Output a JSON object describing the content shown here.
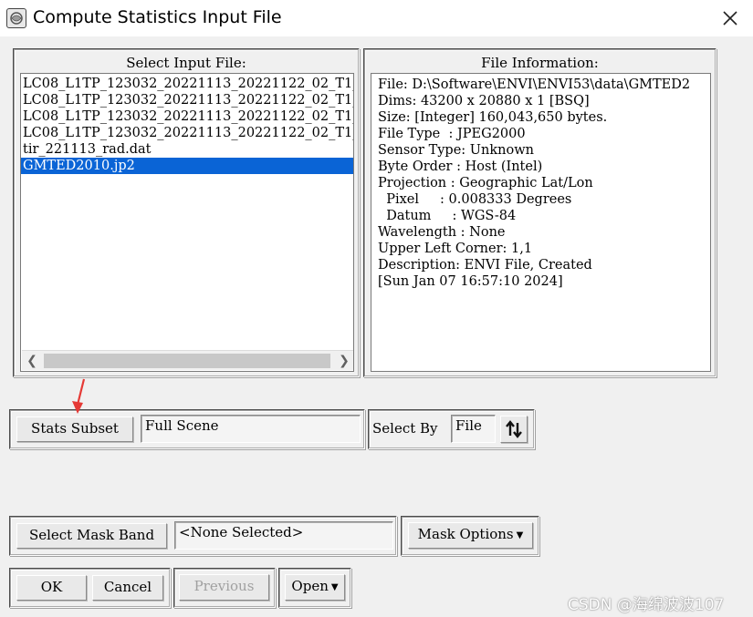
{
  "window": {
    "title": "Compute Statistics Input File",
    "close_icon": "close-icon",
    "app_icon": "envi-app-icon"
  },
  "select_input": {
    "label": "Select Input File:",
    "files": [
      "LC08_L1TP_123032_20221113_20221122_02_T1_",
      "LC08_L1TP_123032_20221113_20221122_02_T1_",
      "LC08_L1TP_123032_20221113_20221122_02_T1_",
      "LC08_L1TP_123032_20221113_20221122_02_T1_",
      "tir_221113_rad.dat",
      "GMTED2010.jp2"
    ],
    "selected_index": 5,
    "scroll_left_icon": "chevron-left-icon",
    "scroll_right_icon": "chevron-right-icon"
  },
  "file_info": {
    "label": "File Information:",
    "lines": [
      "File: D:\\Software\\ENVI\\ENVI53\\data\\GMTED2",
      "Dims: 43200 x 20880 x 1 [BSQ]",
      "Size: [Integer] 160,043,650 bytes.",
      "File Type  : JPEG2000",
      "Sensor Type: Unknown",
      "Byte Order : Host (Intel)",
      "Projection : Geographic Lat/Lon",
      "  Pixel     : 0.008333 Degrees",
      "  Datum     : WGS-84",
      "Wavelength : None",
      "Upper Left Corner: 1,1",
      "Description: ENVI File, Created",
      "[Sun Jan 07 16:57:10 2024]"
    ]
  },
  "stats_subset": {
    "button_label": "Stats Subset",
    "value": "Full Scene"
  },
  "select_by": {
    "label": "Select By",
    "value": "File",
    "sort_icon": "sort-arrows-icon"
  },
  "mask": {
    "button_label": "Select Mask Band",
    "value": "<None Selected>",
    "options_label": "Mask Options"
  },
  "actions": {
    "ok": "OK",
    "cancel": "Cancel",
    "previous": "Previous",
    "open": "Open"
  },
  "watermark": "CSDN @海绵波波107",
  "colors": {
    "selection": "#0a64d6",
    "annotation_arrow": "#e53935"
  }
}
